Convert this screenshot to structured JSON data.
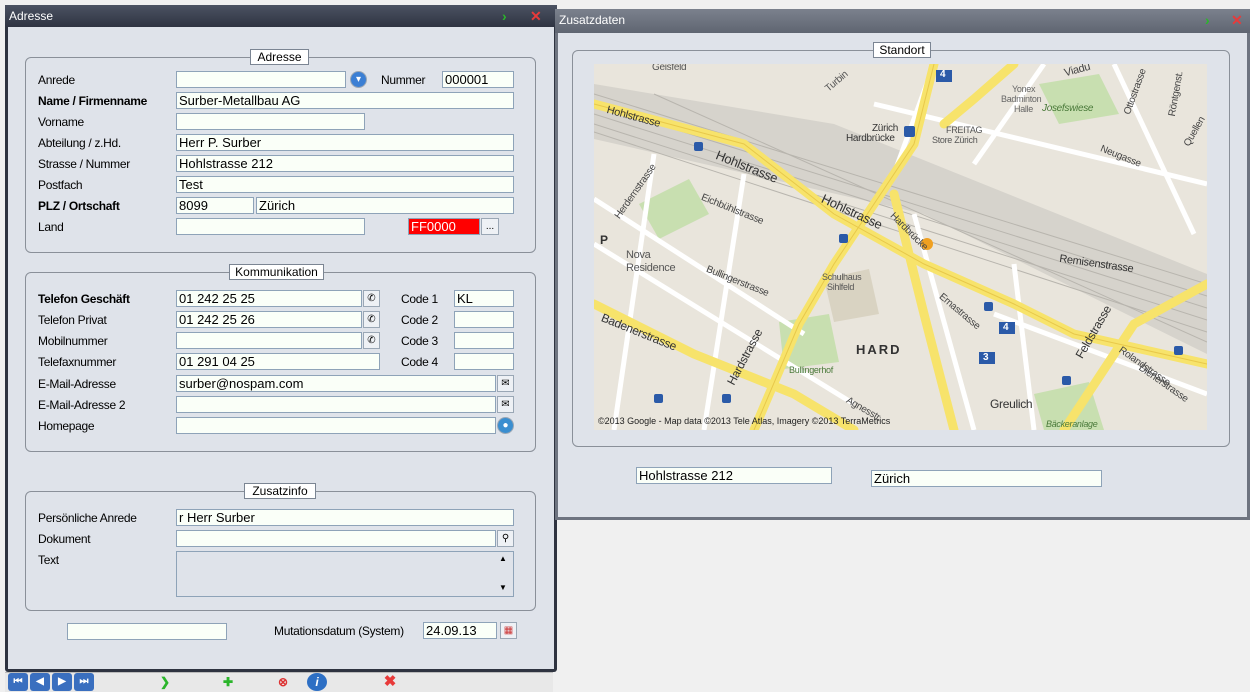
{
  "adresse_window": {
    "title": "Adresse",
    "group_adresse": {
      "legend": "Adresse",
      "anrede_label": "Anrede",
      "anrede_value": "",
      "nummer_label": "Nummer",
      "nummer_value": "000001",
      "name_label": "Name / Firmenname",
      "name_value": "Surber-Metallbau AG",
      "vorname_label": "Vorname",
      "vorname_value": "",
      "abteilung_label": "Abteilung / z.Hd.",
      "abteilung_value": "Herr P. Surber",
      "strasse_label": "Strasse / Nummer",
      "strasse_value": "Hohlstrasse 212",
      "postfach_label": "Postfach",
      "postfach_value": "Test",
      "plz_label": "PLZ / Ortschaft",
      "plz_value": "8099",
      "ort_value": "Zürich",
      "land_label": "Land",
      "land_value": "",
      "color_value": "FF0000",
      "color_button": "..."
    },
    "group_kommunikation": {
      "legend": "Kommunikation",
      "tel_geschaeft_label": "Telefon Geschäft",
      "tel_geschaeft_value": "01 242 25 25",
      "tel_privat_label": "Telefon Privat",
      "tel_privat_value": "01 242 25 26",
      "mobil_label": "Mobilnummer",
      "mobil_value": "",
      "fax_label": "Telefaxnummer",
      "fax_value": "01 291 04 25",
      "email_label": "E-Mail-Adresse",
      "email_value": "surber@nospam.com",
      "email2_label": "E-Mail-Adresse 2",
      "email2_value": "",
      "homepage_label": "Homepage",
      "homepage_value": "",
      "code1_label": "Code 1",
      "code1_value": "KL",
      "code2_label": "Code 2",
      "code2_value": "",
      "code3_label": "Code 3",
      "code3_value": "",
      "code4_label": "Code 4",
      "code4_value": ""
    },
    "group_zusatzinfo": {
      "legend": "Zusatzinfo",
      "pers_anrede_label": "Persönliche Anrede",
      "pers_anrede_value": "r Herr Surber",
      "dokument_label": "Dokument",
      "dokument_value": "",
      "text_label": "Text",
      "text_value": ""
    },
    "footer": {
      "left_value": "",
      "mutation_label": "Mutationsdatum (System)",
      "mutation_value": "24.09.13"
    }
  },
  "zusatz_window": {
    "title": "Zusatzdaten",
    "standort_legend": "Standort",
    "map": {
      "labels": {
        "geisfeld": "Geisfeld",
        "hohlstrasse_left": "Hohlstrasse",
        "hohlstrasse_mid": "Hohlstrasse",
        "hohlstrasse_center": "Hohlstrasse",
        "herdernstrasse": "Herdernstrasse",
        "eichbuehlstrasse": "Eichbühlstrasse",
        "nova_residence_1": "Nova",
        "nova_residence_2": "Residence",
        "bullingerstrasse": "Bullingerstrasse",
        "badenerstrasse": "Badenerstrasse",
        "hardstrasse": "Hardstrasse",
        "hard": "HARD",
        "bullingerhof": "Bullingerhof",
        "schulhaus_1": "Schulhaus",
        "schulhaus_2": "Sihlfeld",
        "hardbruecke_str": "Hardbrücke",
        "zuerich_hb_1": "Zürich",
        "zuerich_hb_2": "Hardbrücke",
        "freitag_1": "FREITAG",
        "freitag_2": "Store Zürich",
        "yonex_1": "Yonex",
        "yonex_2": "Badminton",
        "yonex_3": "Halle",
        "josefswiese": "Josefswiese",
        "ottostrasse": "Ottostrasse",
        "roentgenstr": "Röntgenst.",
        "quellenstr": "Quellen",
        "neugasse": "Neugasse",
        "remisenstrasse": "Remisenstrasse",
        "ernastrasse": "Ernastrasse",
        "feldstrasse": "Feldstrasse",
        "rolandstrasse": "Rolandstrasse",
        "dienerstrasse": "Dienerstrasse",
        "greulich": "Greulich",
        "baeckeranlage": "Bäckeranlage",
        "agnesstrasse": "Agnesstr.",
        "viadukt": "Viadu",
        "p_marker": "P",
        "shield_4a": "4",
        "shield_4b": "4",
        "shield_3": "3",
        "turbinen": "Turbin"
      },
      "attribution": "©2013 Google - Map data ©2013 Tele Atlas, Imagery ©2013 TerraMetrics"
    },
    "street_value": "Hohlstrasse 212",
    "city_value": "Zürich"
  },
  "toolbar": {
    "first_icon": "first-record-icon",
    "prev_icon": "previous-record-icon",
    "next_icon": "next-record-icon",
    "last_icon": "last-record-icon",
    "play_icon": "play-icon",
    "new_icon": "new-record-icon",
    "delete_icon": "delete-record-icon",
    "info_icon": "info-icon",
    "close_icon": "close-icon"
  },
  "colors": {
    "titlebar": "#3b4150",
    "client": "#dfe3ea",
    "input_bg": "#fafff8",
    "color_field": "#ff0000",
    "go_arrow": "#2bb52b",
    "close_x": "#e83a3a"
  }
}
